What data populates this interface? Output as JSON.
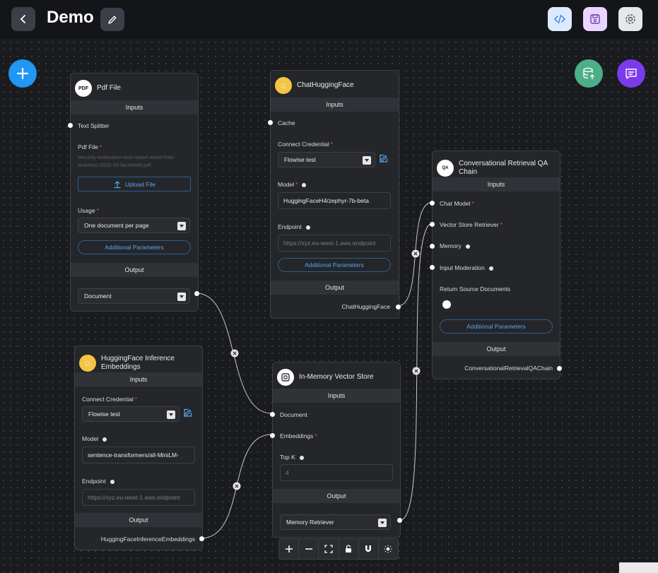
{
  "header": {
    "title": "Demo"
  },
  "icons": {
    "back": "chevron-left-icon",
    "edit": "pencil-icon",
    "code": "code-icon",
    "save": "floppy-icon",
    "settings": "gear-icon",
    "add": "plus-icon",
    "upsert": "database-upload-icon",
    "chat": "chat-icon"
  },
  "colors": {
    "code_btn": "#dbeafe",
    "save_btn": "#e9d5ff",
    "settings_btn": "#e5e7eb",
    "add_fab": "#2196f3",
    "upsert_fab": "#4caf87",
    "chat_fab": "#7c3aed",
    "accent": "#5aa7ef",
    "required": "#e8535a"
  },
  "nodes": {
    "pdf": {
      "title": "Pdf File",
      "icon_text": "PDF",
      "inputs_label": "Inputs",
      "text_splitter": "Text Splitter",
      "pdf_file_label": "Pdf File",
      "pdf_file_value": "security-evaluation-test-report-avast-free-antivirus-2025-05-factsheet.pdf",
      "upload_label": "Upload File",
      "usage_label": "Usage",
      "usage_value": "One document per page",
      "additional": "Additional Parameters",
      "output_label": "Output",
      "output_value": "Document"
    },
    "chat": {
      "title": "ChatHuggingFace",
      "inputs_label": "Inputs",
      "cache": "Cache",
      "credential_label": "Connect Credential",
      "credential_value": "Flowise test",
      "model_label": "Model",
      "model_value": "HuggingFaceH4/zephyr-7b-beta",
      "endpoint_label": "Endpoint",
      "endpoint_placeholder": "https://xyz.eu-west-1.aws.endpoint",
      "additional": "Additional Parameters",
      "output_label": "Output",
      "output_value": "ChatHuggingFace"
    },
    "qa": {
      "title": "Conversational Retrieval QA Chain",
      "icon_text": "QA",
      "inputs_label": "Inputs",
      "chat_model": "Chat Model",
      "vector_retriever": "Vector Store Retriever",
      "memory": "Memory",
      "moderation": "Input Moderation",
      "return_source": "Return Source Documents",
      "return_source_on": false,
      "additional": "Additional Parameters",
      "output_label": "Output",
      "output_value": "ConversationalRetrievalQAChain"
    },
    "embed": {
      "title": "HuggingFace Inference Embeddings",
      "inputs_label": "Inputs",
      "credential_label": "Connect Credential",
      "credential_value": "Flowise test",
      "model_label": "Model",
      "model_value": "sentence-transformers/all-MiniLM-",
      "endpoint_label": "Endpoint",
      "endpoint_placeholder": "https://xyz.eu-west-1.aws.endpoint",
      "output_label": "Output",
      "output_value": "HuggingFaceInferenceEmbeddings"
    },
    "store": {
      "title": "In-Memory Vector Store",
      "inputs_label": "Inputs",
      "document": "Document",
      "embeddings": "Embeddings",
      "topk_label": "Top K",
      "topk_placeholder": "4",
      "output_label": "Output",
      "output_value": "Memory Retriever"
    }
  },
  "controls": [
    "zoom-in-icon",
    "zoom-out-icon",
    "fit-view-icon",
    "lock-icon",
    "magnet-icon",
    "sun-icon"
  ]
}
